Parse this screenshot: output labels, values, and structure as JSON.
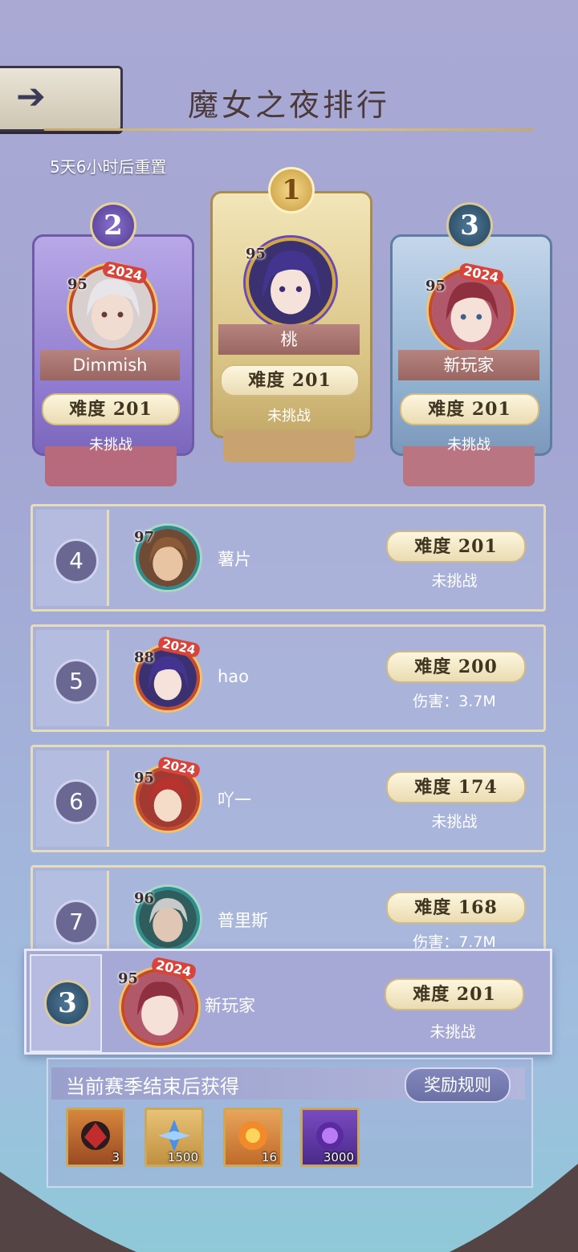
{
  "header": {
    "title": "魔女之夜排行",
    "reset_text": "5天6小时后重置"
  },
  "podium": [
    {
      "rank": "2",
      "level": "95",
      "badge": "2024",
      "name": "Dimmish",
      "difficulty": "难度 201",
      "status": "未挑战"
    },
    {
      "rank": "1",
      "level": "95",
      "badge": "",
      "name": "桃",
      "difficulty": "难度 201",
      "status": "未挑战"
    },
    {
      "rank": "3",
      "level": "95",
      "badge": "2024",
      "name": "新玩家",
      "difficulty": "难度 201",
      "status": "未挑战"
    }
  ],
  "list": [
    {
      "rank": "4",
      "level": "97",
      "badge": "",
      "name": "薯片",
      "difficulty": "难度 201",
      "sub": "未挑战"
    },
    {
      "rank": "5",
      "level": "88",
      "badge": "2024",
      "name": "hao",
      "difficulty": "难度 200",
      "sub": "伤害：3.7M"
    },
    {
      "rank": "6",
      "level": "95",
      "badge": "2024",
      "name": "吖一",
      "difficulty": "难度 174",
      "sub": "未挑战"
    },
    {
      "rank": "7",
      "level": "96",
      "badge": "",
      "name": "普里斯",
      "difficulty": "难度 168",
      "sub": "伤害：7.7M"
    }
  ],
  "me": {
    "rank": "3",
    "level": "95",
    "badge": "2024",
    "name": "新玩家",
    "difficulty": "难度 201",
    "sub": "未挑战"
  },
  "rewards": {
    "label": "当前赛季结束后获得",
    "rules_button": "奖励规则",
    "items": [
      {
        "icon": "dark-dragon-icon",
        "count": "3"
      },
      {
        "icon": "blue-crystal-icon",
        "count": "1500"
      },
      {
        "icon": "sun-flower-icon",
        "count": "16"
      },
      {
        "icon": "purple-orb-icon",
        "count": "3000"
      }
    ]
  },
  "colors": {
    "gold": "#d9c384",
    "purple": "#8f7bcf",
    "blue": "#8fafcf",
    "accent_red": "#c44a2a"
  }
}
